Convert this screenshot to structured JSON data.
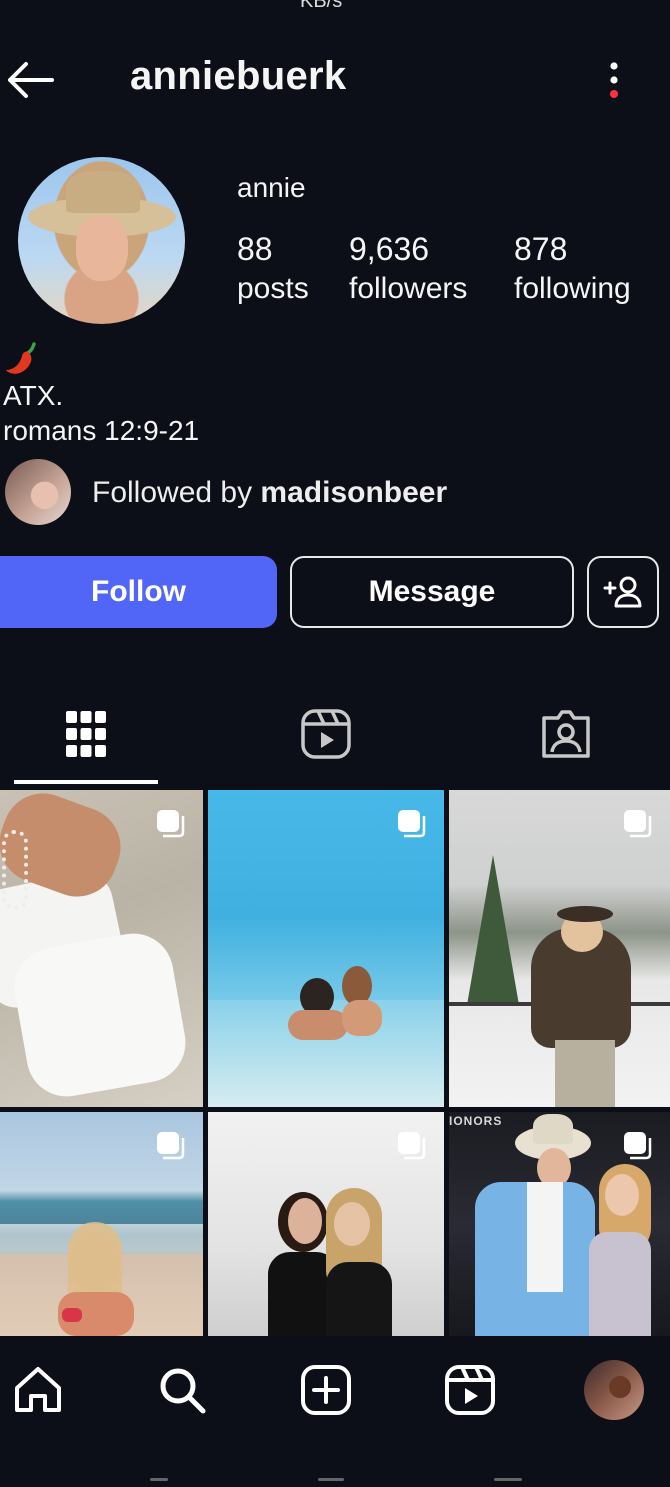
{
  "status_bar": {
    "left": "...",
    "right": "KB/s"
  },
  "header": {
    "title": "anniebuerk",
    "back_icon": "arrow-left-icon",
    "more_icon": "more-vertical-icon"
  },
  "profile": {
    "display_name": "annie",
    "stats": [
      {
        "value": "88",
        "label": "posts"
      },
      {
        "value": "9,636",
        "label": "followers"
      },
      {
        "value": "878",
        "label": "following"
      }
    ],
    "bio": {
      "emoji_icon": "chili-pepper-emoji",
      "lines": [
        "ATX.",
        "romans 12:9-21"
      ]
    },
    "followed_by": {
      "prefix": "Followed by ",
      "username": "madisonbeer"
    }
  },
  "actions": {
    "follow_label": "Follow",
    "message_label": "Message",
    "suggest_icon": "add-person-icon",
    "colors": {
      "follow": "#5165f6"
    }
  },
  "tabs": [
    {
      "icon": "grid-icon",
      "selected": true
    },
    {
      "icon": "reels-icon",
      "selected": false
    },
    {
      "icon": "tagged-icon",
      "selected": false
    }
  ],
  "grid": {
    "posts": [
      {
        "description": "white outfit with shell necklace",
        "multi": true
      },
      {
        "description": "couple in turquoise water",
        "multi": true
      },
      {
        "description": "cowgirl in fur coat in snow",
        "multi": true
      },
      {
        "description": "woman on beach in red bikini",
        "multi": true
      },
      {
        "description": "two women in black dresses",
        "multi": true
      },
      {
        "description": "couple at event with cowboy hat",
        "multi": true,
        "overlay_text": "IONORS"
      }
    ]
  },
  "bottom_nav": [
    {
      "icon": "home-icon"
    },
    {
      "icon": "search-icon"
    },
    {
      "icon": "create-icon"
    },
    {
      "icon": "reels-icon"
    },
    {
      "icon": "profile-avatar"
    }
  ],
  "colors": {
    "background": "#0c0f17",
    "notification_dot": "#ff3040"
  }
}
